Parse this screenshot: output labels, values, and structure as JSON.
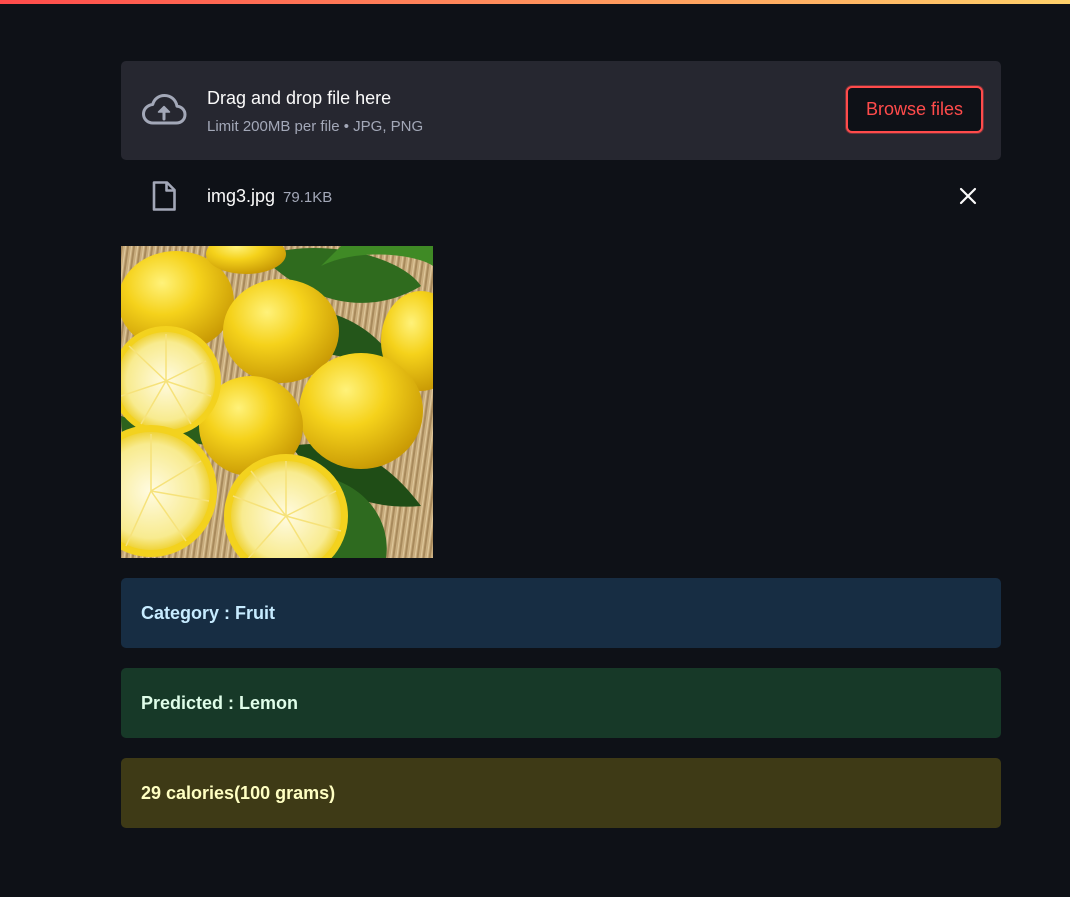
{
  "uploader": {
    "title": "Drag and drop file here",
    "subtitle": "Limit 200MB per file • JPG, PNG",
    "browse_label": "Browse files",
    "icon": "cloud-upload-icon"
  },
  "uploaded_file": {
    "name": "img3.jpg",
    "size": "79.1KB",
    "icon": "file-icon",
    "remove_icon": "close-icon"
  },
  "image": {
    "description_icon": "lemons-photo"
  },
  "results": {
    "category": "Category : Fruit",
    "predicted": "Predicted : Lemon",
    "calories": "29 calories(100 grams)"
  },
  "colors": {
    "accent": "#ff4b4b",
    "background": "#0e1117",
    "info_bg": "#172d43",
    "success_bg": "#173928",
    "warning_bg": "#3e3a16"
  }
}
